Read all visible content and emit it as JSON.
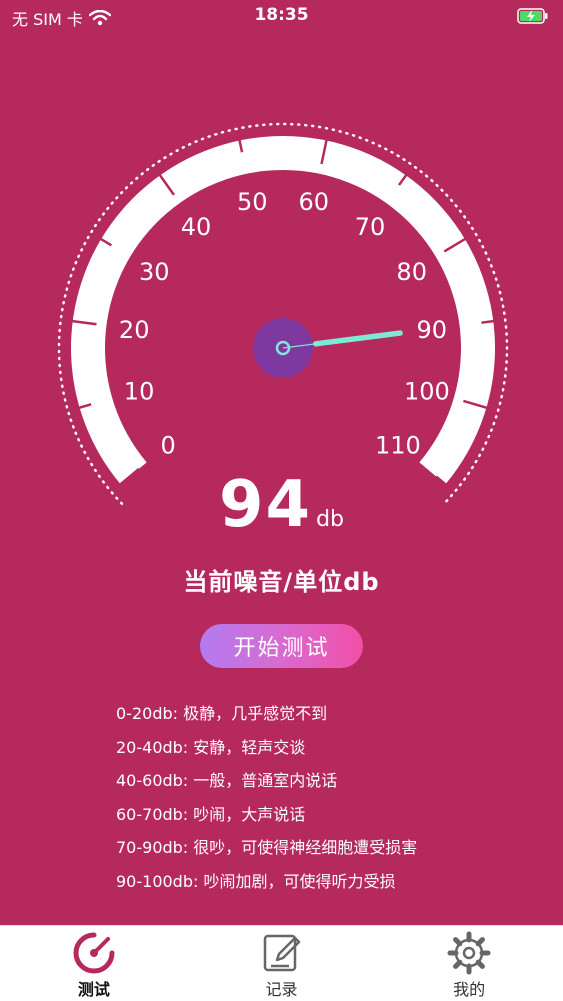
{
  "status_bar": {
    "carrier": "无 SIM 卡",
    "time": "18:35",
    "wifi_icon": "wifi-icon",
    "battery_icon": "battery-charging-icon"
  },
  "gauge": {
    "tick_labels": [
      "0",
      "10",
      "20",
      "30",
      "40",
      "50",
      "60",
      "70",
      "80",
      "90",
      "100",
      "110"
    ],
    "needle_value": 90,
    "band_color": "#ffffff",
    "needle_color": "#7ee8d6",
    "hub_color": "#7a3aa8"
  },
  "reading": {
    "value": "94",
    "unit": "db"
  },
  "caption": "当前噪音/单位db",
  "start_button": {
    "label": "开始测试"
  },
  "legend": [
    "0-20db: 极静，几乎感觉不到",
    "20-40db: 安静，轻声交谈",
    "40-60db: 一般，普通室内说话",
    "60-70db: 吵闹，大声说话",
    "70-90db: 很吵，可使得神经细胞遭受损害",
    "90-100db: 吵闹加剧，可使得听力受损"
  ],
  "tabs": [
    {
      "label": "测试",
      "icon": "gauge-icon",
      "active": true
    },
    {
      "label": "记录",
      "icon": "edit-icon",
      "active": false
    },
    {
      "label": "我的",
      "icon": "gear-icon",
      "active": false
    }
  ],
  "colors": {
    "background": "#b5295c",
    "accent": "#b5295c"
  }
}
